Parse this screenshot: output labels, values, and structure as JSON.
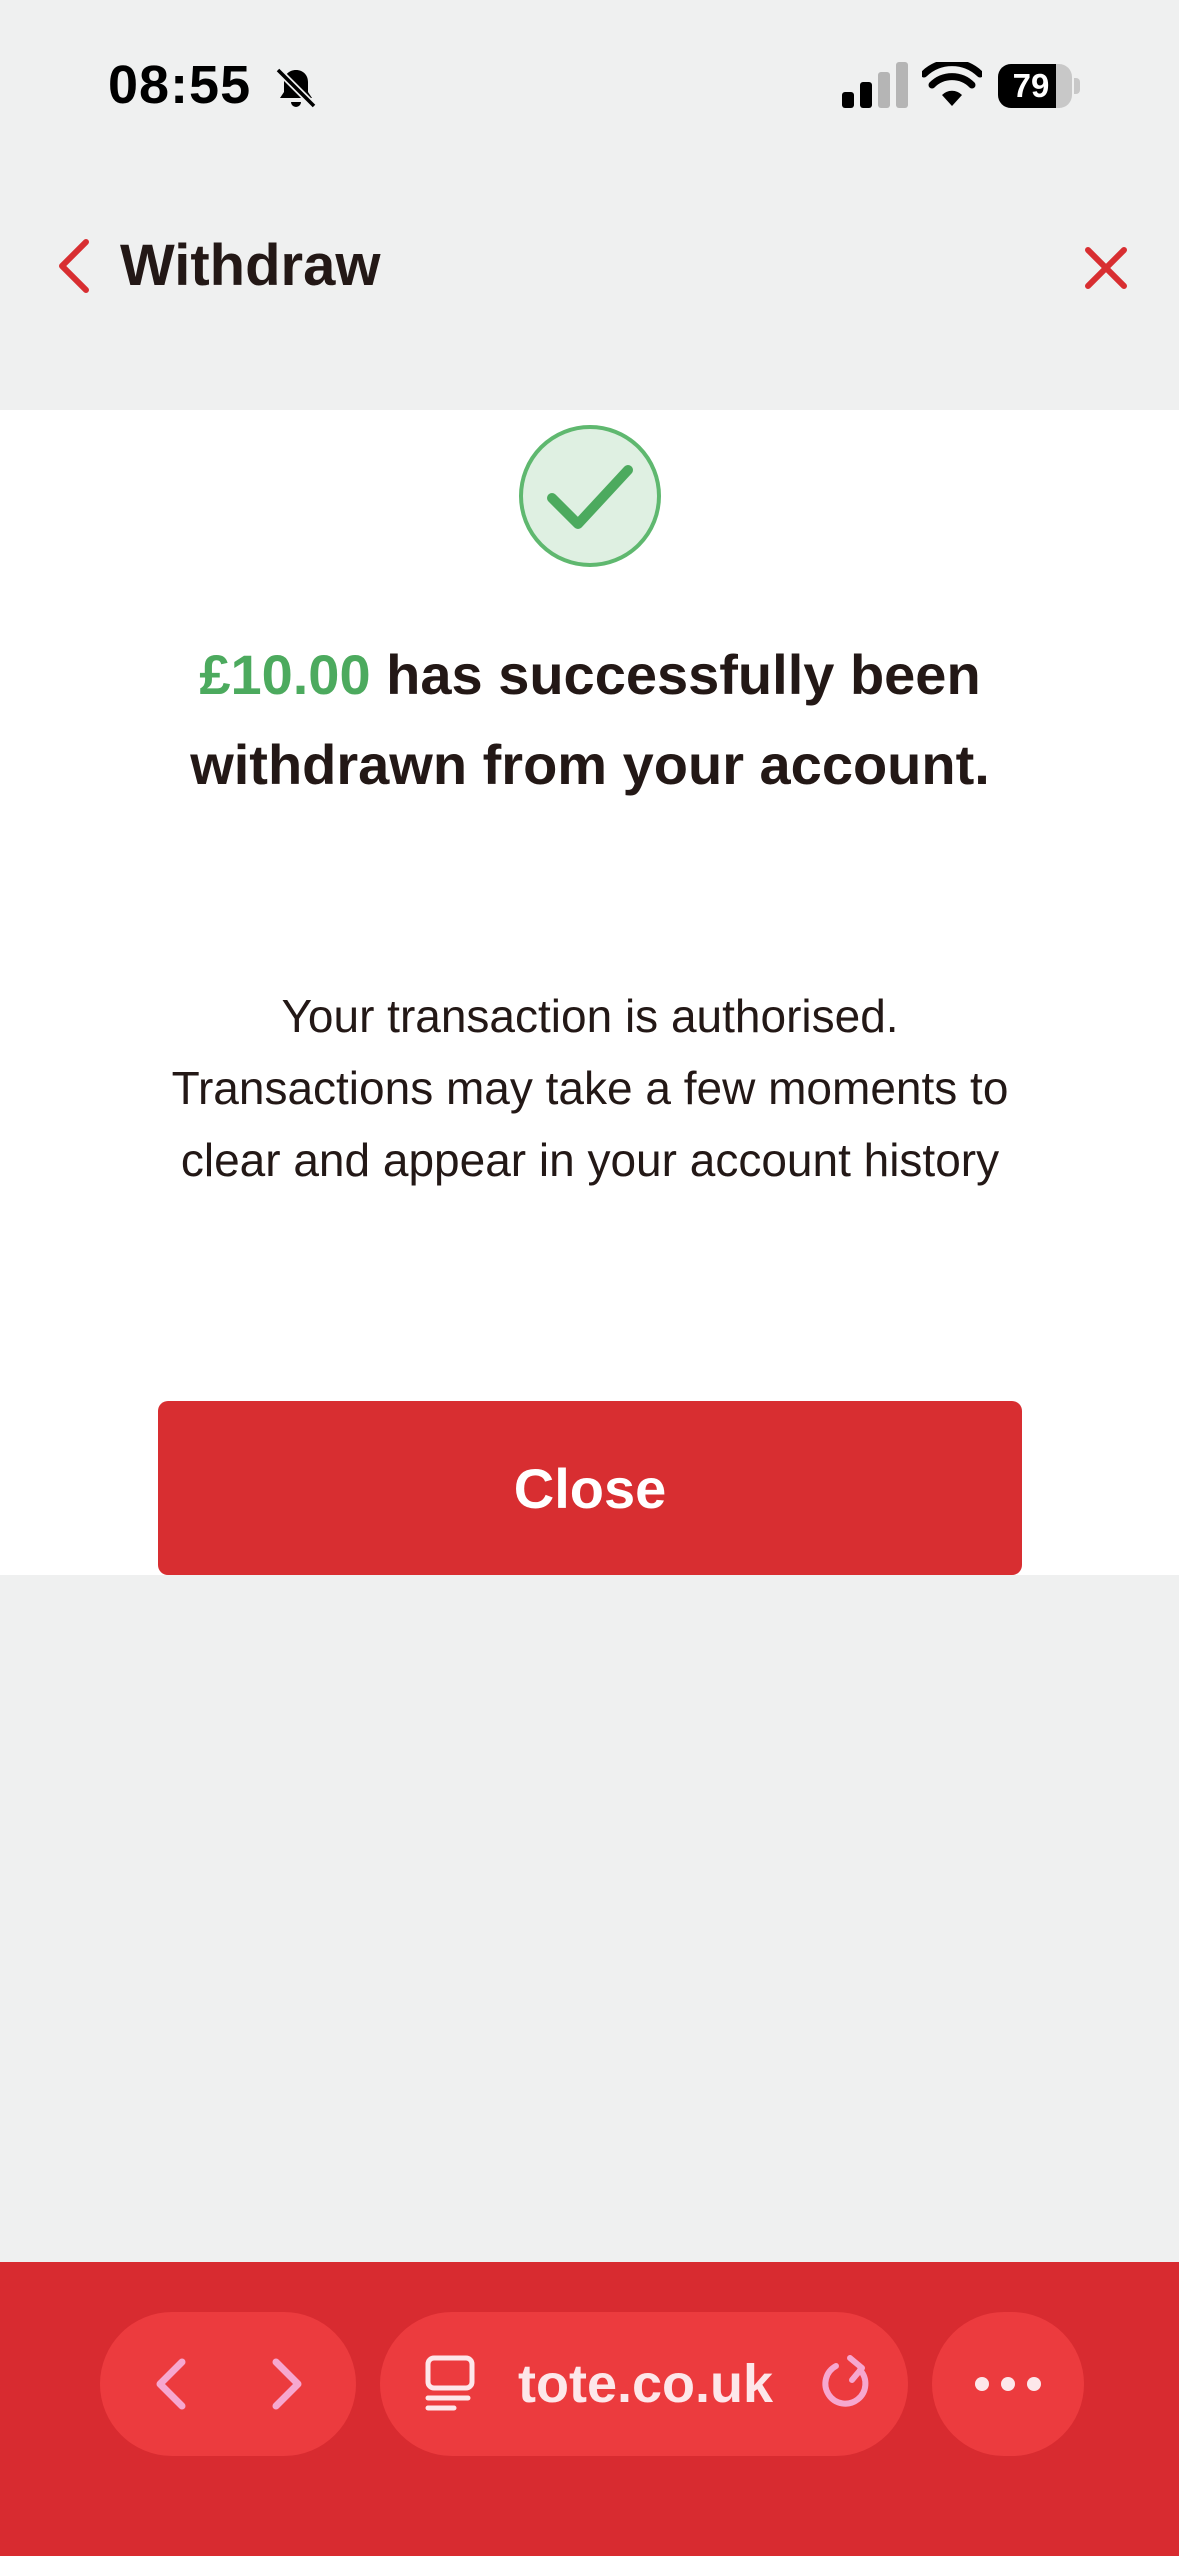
{
  "status_bar": {
    "time": "08:55",
    "battery_level": "79",
    "battery_fraction": 0.79,
    "icons": [
      "bell-slash-icon",
      "cellular-signal-icon",
      "wifi-icon",
      "battery-icon"
    ]
  },
  "header": {
    "title": "Withdraw",
    "back_icon": "chevron-left-icon",
    "close_icon": "close-icon"
  },
  "success": {
    "icon": "check-circle-icon",
    "amount": "£10.00",
    "message": " has successfully been withdrawn from your account.",
    "info": "Your transaction is authorised. Transactions may take a few moments to clear and appear in your account history",
    "close_label": "Close"
  },
  "browser": {
    "url": "tote.co.uk",
    "icons": [
      "chevron-left-icon",
      "chevron-right-icon",
      "tabs-icon",
      "reload-icon",
      "more-icon"
    ]
  },
  "colors": {
    "brand_red": "#d82e31",
    "success_green": "#4caa5e",
    "background": "#eff0f0",
    "text": "#231816"
  }
}
